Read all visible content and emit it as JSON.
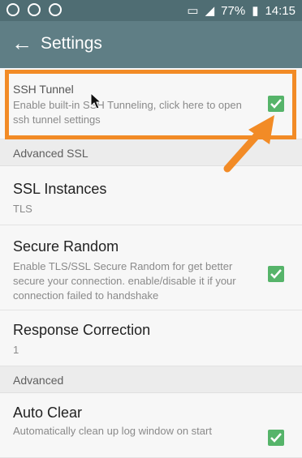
{
  "status_bar": {
    "battery": "77%",
    "time": "14:15"
  },
  "app_bar": {
    "title": "Settings"
  },
  "items": {
    "ssh_tunnel": {
      "title": "SSH Tunnel",
      "summary": "Enable built-in SSH Tunneling, click here to open ssh tunnel settings",
      "checked": true
    },
    "advanced_ssl_header": "Advanced SSL",
    "ssl_instances": {
      "title": "SSL Instances",
      "summary": "TLS"
    },
    "secure_random": {
      "title": "Secure Random",
      "summary": "Enable TLS/SSL Secure Random for get better secure your connection. enable/disable it if your connection failed to handshake",
      "checked": true
    },
    "response_correction": {
      "title": "Response Correction",
      "summary": "1"
    },
    "advanced_header": "Advanced",
    "auto_clear": {
      "title": "Auto Clear",
      "summary": "Automatically clean up log window on start",
      "checked": true
    }
  },
  "colors": {
    "status_bar": "#4f6d73",
    "app_bar": "#5f7e85",
    "checkbox": "#56b46a",
    "annotation": "#f28b26"
  }
}
